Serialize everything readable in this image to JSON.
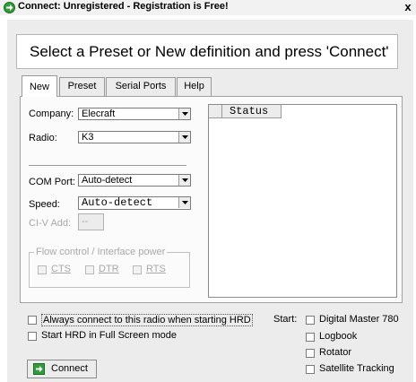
{
  "window": {
    "title": "Connect: Unregistered - Registration is Free!",
    "close_glyph": "x",
    "header": "Select a Preset or New definition and press 'Connect'"
  },
  "tabs": [
    {
      "label": "New",
      "selected": true
    },
    {
      "label": "Preset",
      "selected": false
    },
    {
      "label": "Serial Ports",
      "selected": false
    },
    {
      "label": "Help",
      "selected": false
    }
  ],
  "form": {
    "company_label": "Company:",
    "company_value": "Elecraft",
    "radio_label": "Radio:",
    "radio_value": "K3",
    "com_port_label": "COM Port:",
    "com_port_value": "Auto-detect",
    "speed_label": "Speed:",
    "speed_value": "Auto-detect",
    "civ_label": "CI-V Add:",
    "civ_value": "--",
    "flow_group_label": "Flow control / Interface power",
    "flow_options": [
      "CTS",
      "DTR",
      "RTS"
    ]
  },
  "status_list": {
    "column_header": "Status"
  },
  "options": {
    "always_connect": "Always connect to this radio when starting HRD",
    "full_screen": "Start HRD in Full Screen mode"
  },
  "start": {
    "label": "Start:",
    "items": [
      "Digital Master 780",
      "Logbook",
      "Rotator",
      "Satellite Tracking"
    ]
  },
  "connect_button": "Connect",
  "colors": {
    "accent_green": "#2e9e3a",
    "panel_bg": "#ececec"
  },
  "icons": {
    "app": "green-arrow-icon",
    "connect": "green-arrow-icon",
    "dropdown": "chevron-down-icon"
  }
}
